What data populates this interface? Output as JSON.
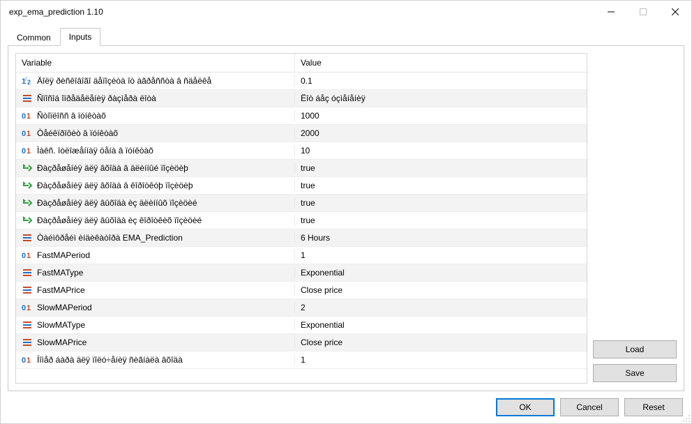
{
  "window": {
    "title": "exp_ema_prediction 1.10"
  },
  "tabs": {
    "common": "Common",
    "inputs": "Inputs"
  },
  "grid": {
    "header_variable": "Variable",
    "header_value": "Value",
    "rows": [
      {
        "icon": "half",
        "variable": "Äîëÿ ðèñêîâîãî äåïîçèòà îò àãðåññòà â ñäåëêå",
        "value": "0.1"
      },
      {
        "icon": "enum",
        "variable": "Ñïîñîá îïðåäåëåíèÿ ðàçìåðà ëîòà",
        "value": "Ëîò áåç óçìåíåíèÿ"
      },
      {
        "icon": "int",
        "variable": "Ñòîïëîññ â ïóíêòàõ",
        "value": "1000"
      },
      {
        "icon": "int",
        "variable": "Òåéêïðîôèò â ïóíêòàõ",
        "value": "2000"
      },
      {
        "icon": "int",
        "variable": "Ìàêñ. îòëîæåííàÿ öåíà â ïóíêòàõ",
        "value": "10"
      },
      {
        "icon": "bool",
        "variable": "Ðàçðåøåíèÿ äëÿ âõîäà â äëèííûé ïîçèöèþ",
        "value": "true"
      },
      {
        "icon": "bool",
        "variable": "Ðàçðåøåíèÿ äëÿ âõîäà â êîðîòêóþ ïîçèöèþ",
        "value": "true"
      },
      {
        "icon": "bool",
        "variable": "Ðàçðåøåíèÿ äëÿ âûõîäà èç äëèííûõ ïîçèöèé",
        "value": "true"
      },
      {
        "icon": "bool",
        "variable": "Ðàçðåøåíèÿ äëÿ âûõîäà èç êîðîòêèõ ïîçèöèé",
        "value": "true"
      },
      {
        "icon": "enum",
        "variable": "Òàéìôðåéì èíäèêàòîðà EMA_Prediction",
        "value": "6 Hours"
      },
      {
        "icon": "int",
        "variable": "FastMAPeriod",
        "value": "1"
      },
      {
        "icon": "enum",
        "variable": "FastMAType",
        "value": "Exponential"
      },
      {
        "icon": "enum",
        "variable": "FastMAPrice",
        "value": "Close price"
      },
      {
        "icon": "int",
        "variable": "SlowMAPeriod",
        "value": "2"
      },
      {
        "icon": "enum",
        "variable": "SlowMAType",
        "value": "Exponential"
      },
      {
        "icon": "enum",
        "variable": "SlowMAPrice",
        "value": "Close price"
      },
      {
        "icon": "int",
        "variable": "Íîìåð áàðà äëÿ ïîëó÷åíèÿ ñèãíàëà âõîäà",
        "value": "1"
      }
    ]
  },
  "buttons": {
    "load": "Load",
    "save": "Save",
    "ok": "OK",
    "cancel": "Cancel",
    "reset": "Reset"
  }
}
